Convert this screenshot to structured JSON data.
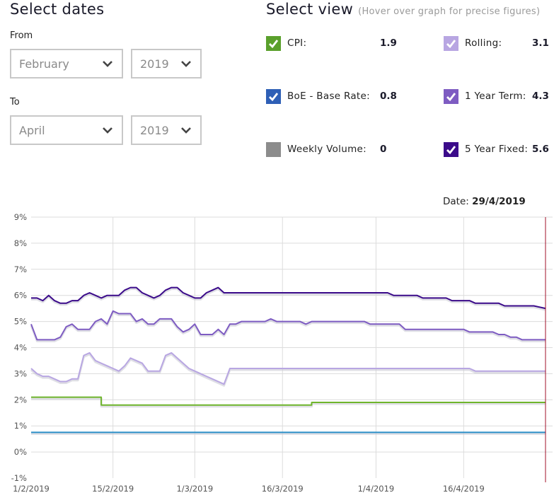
{
  "dates_panel": {
    "title": "Select dates",
    "from_label": "From",
    "from_month": "February",
    "from_year": "2019",
    "to_label": "To",
    "to_month": "April",
    "to_year": "2019"
  },
  "view_panel": {
    "title": "Select view",
    "hint": "(Hover over graph for precise figures)",
    "items": [
      {
        "name": "CPI:",
        "value": "1.9",
        "checked": true,
        "color": "#5aa02c"
      },
      {
        "name": "BoE - Base Rate:",
        "value": "0.8",
        "checked": true,
        "color": "#2e5fb6"
      },
      {
        "name": "Weekly Volume:",
        "value": "0",
        "checked": false,
        "color": "#8c8c8c"
      },
      {
        "name": "Rolling:",
        "value": "3.1",
        "checked": true,
        "color": "#b8a6e2"
      },
      {
        "name": "1 Year Term:",
        "value": "4.3",
        "checked": true,
        "color": "#7e5cc2"
      },
      {
        "name": "5 Year Fixed:",
        "value": "5.6",
        "checked": true,
        "color": "#3b0b8a"
      }
    ]
  },
  "hover": {
    "label": "Date:",
    "value": "29/4/2019"
  },
  "chart_data": {
    "type": "line",
    "title": "",
    "xlabel": "",
    "ylabel": "",
    "x_range_days": [
      0,
      88
    ],
    "x_start_date": "1/2/2019",
    "x_ticks": [
      {
        "day": 0,
        "label": "1/2/2019"
      },
      {
        "day": 14,
        "label": "15/2/2019"
      },
      {
        "day": 28,
        "label": "1/3/2019"
      },
      {
        "day": 43,
        "label": "16/3/2019"
      },
      {
        "day": 59,
        "label": "1/4/2019"
      },
      {
        "day": 74,
        "label": "16/4/2019"
      }
    ],
    "ylim": [
      -1,
      9
    ],
    "y_ticks": [
      "-1%",
      "0%",
      "1%",
      "2%",
      "3%",
      "4%",
      "5%",
      "6%",
      "7%",
      "8%",
      "9%"
    ],
    "y_tick_values": [
      -1,
      0,
      1,
      2,
      3,
      4,
      5,
      6,
      7,
      8,
      9
    ],
    "grid": true,
    "hover_day": 88,
    "series": [
      {
        "name": "5 Year Fixed",
        "color": "#3b0b8a",
        "x": [
          0,
          1,
          2,
          3,
          4,
          5,
          6,
          7,
          8,
          9,
          10,
          11,
          12,
          13,
          14,
          15,
          16,
          17,
          18,
          19,
          20,
          21,
          22,
          23,
          24,
          25,
          26,
          27,
          28,
          29,
          30,
          31,
          32,
          33,
          34,
          35,
          61,
          62,
          66,
          67,
          71,
          72,
          75,
          76,
          80,
          81,
          85,
          86,
          88
        ],
        "y": [
          5.9,
          5.9,
          5.8,
          6.0,
          5.8,
          5.7,
          5.7,
          5.8,
          5.8,
          6.0,
          6.1,
          6.0,
          5.9,
          6.0,
          6.0,
          6.0,
          6.2,
          6.3,
          6.3,
          6.1,
          6.0,
          5.9,
          6.0,
          6.2,
          6.3,
          6.3,
          6.1,
          6.0,
          5.9,
          5.9,
          6.1,
          6.2,
          6.3,
          6.1,
          6.1,
          6.1,
          6.1,
          6.0,
          6.0,
          5.9,
          5.9,
          5.8,
          5.8,
          5.7,
          5.7,
          5.6,
          5.6,
          5.6,
          5.5
        ]
      },
      {
        "name": "1 Year Term",
        "color": "#7e5cc2",
        "x": [
          0,
          1,
          2,
          3,
          4,
          5,
          6,
          7,
          8,
          9,
          10,
          11,
          12,
          13,
          14,
          15,
          16,
          17,
          18,
          19,
          20,
          21,
          22,
          23,
          24,
          25,
          26,
          27,
          28,
          29,
          30,
          31,
          32,
          33,
          34,
          35,
          36,
          37,
          38,
          40,
          41,
          42,
          43,
          44,
          45,
          46,
          47,
          48,
          57,
          58,
          63,
          64,
          68,
          69,
          74,
          75,
          79,
          80,
          81,
          82,
          83,
          84,
          86,
          88
        ],
        "y": [
          4.9,
          4.3,
          4.3,
          4.3,
          4.3,
          4.4,
          4.8,
          4.9,
          4.7,
          4.7,
          4.7,
          5.0,
          5.1,
          4.9,
          5.4,
          5.3,
          5.3,
          5.3,
          5.0,
          5.1,
          4.9,
          4.9,
          5.1,
          5.1,
          5.1,
          4.8,
          4.6,
          4.7,
          4.9,
          4.5,
          4.5,
          4.5,
          4.7,
          4.5,
          4.9,
          4.9,
          5.0,
          5.0,
          5.0,
          5.0,
          5.1,
          5.0,
          5.0,
          5.0,
          5.0,
          5.0,
          4.9,
          5.0,
          5.0,
          4.9,
          4.9,
          4.7,
          4.7,
          4.7,
          4.7,
          4.6,
          4.6,
          4.5,
          4.5,
          4.4,
          4.4,
          4.3,
          4.3,
          4.3
        ]
      },
      {
        "name": "Rolling",
        "color": "#b8a6e2",
        "x": [
          0,
          1,
          2,
          3,
          4,
          5,
          6,
          7,
          8,
          9,
          10,
          11,
          12,
          13,
          14,
          15,
          16,
          17,
          18,
          19,
          20,
          21,
          22,
          23,
          24,
          25,
          26,
          27,
          28,
          29,
          30,
          31,
          32,
          33,
          34,
          35,
          36,
          37,
          38,
          45,
          57,
          63,
          75,
          76,
          88
        ],
        "y": [
          3.2,
          3.0,
          2.9,
          2.9,
          2.8,
          2.7,
          2.7,
          2.8,
          2.8,
          3.7,
          3.8,
          3.5,
          3.4,
          3.3,
          3.2,
          3.1,
          3.3,
          3.6,
          3.5,
          3.4,
          3.1,
          3.1,
          3.1,
          3.7,
          3.8,
          3.6,
          3.4,
          3.2,
          3.1,
          3.0,
          2.9,
          2.8,
          2.7,
          2.6,
          3.2,
          3.2,
          3.2,
          3.2,
          3.2,
          3.2,
          3.2,
          3.2,
          3.2,
          3.1,
          3.1
        ]
      },
      {
        "name": "CPI",
        "color": "#6fb52c",
        "step": true,
        "x": [
          0,
          12,
          12,
          48,
          48,
          88
        ],
        "y": [
          2.1,
          2.1,
          1.8,
          1.8,
          1.9,
          1.9
        ]
      },
      {
        "name": "BoE - Base Rate",
        "color": "#2b8fc8",
        "x": [
          0,
          88
        ],
        "y": [
          0.75,
          0.75
        ]
      }
    ]
  }
}
